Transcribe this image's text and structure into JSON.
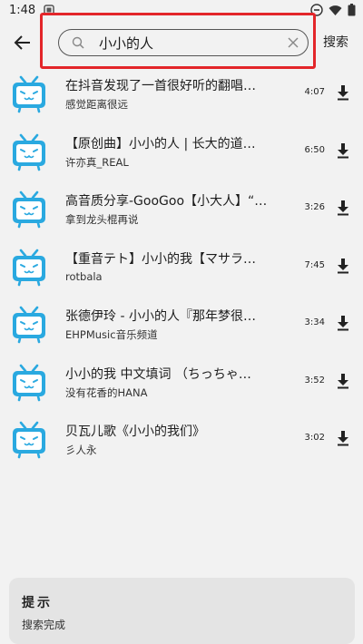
{
  "status_bar": {
    "time": "1:48"
  },
  "search": {
    "query": "小小的人",
    "button_label": "搜索"
  },
  "colors": {
    "accent": "#2aa9e0",
    "highlight": "#e3262a"
  },
  "results": [
    {
      "title": "在抖音发现了一首很好听的翻唱…",
      "artist": "感觉距离很远",
      "duration": "4:07"
    },
    {
      "title": "【原创曲】小小的人 | 长大的道…",
      "artist": "许亦真_REAL",
      "duration": "6:50"
    },
    {
      "title": "高音质分享-GooGoo【小大人】“…",
      "artist": "拿到龙头棍再说",
      "duration": "3:26"
    },
    {
      "title": "【重音テト】小小的我【マサラ…",
      "artist": "rotbala",
      "duration": "7:45"
    },
    {
      "title": "张德伊玲 - 小小的人『那年梦很…",
      "artist": "EHPMusic音乐频道",
      "duration": "3:34"
    },
    {
      "title": "小小的我 中文填词 （ちっちゃ…",
      "artist": "没有花香的HANA",
      "duration": "3:52"
    },
    {
      "title": "贝瓦儿歌《小小的我们》",
      "artist": "彡人永",
      "duration": "3:02"
    }
  ],
  "toast": {
    "title": "提示",
    "message": "搜索完成"
  }
}
